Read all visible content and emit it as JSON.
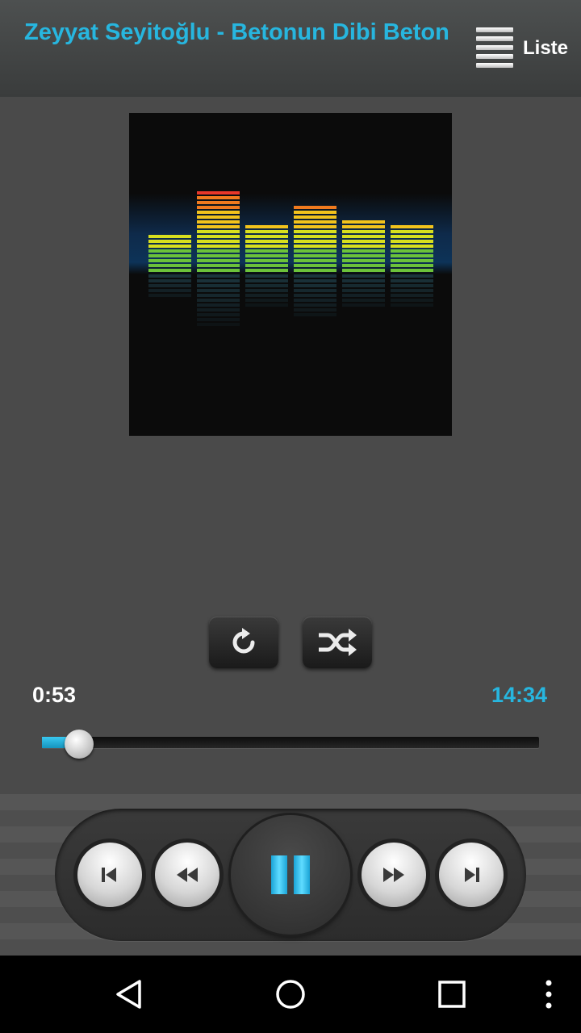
{
  "header": {
    "title": "Zeyyat Seyitoğlu - Betonun Dibi Beton",
    "list_label": "Liste",
    "title_color": "#27b6df"
  },
  "player": {
    "elapsed": "0:53",
    "duration": "14:34",
    "progress": 0.061,
    "state": "playing",
    "accent_color": "#27b6df"
  },
  "album_art": {
    "bar_levels": [
      0.45,
      1.0,
      0.6,
      0.82,
      0.65,
      0.6
    ]
  },
  "icons": {
    "repeat": "repeat-icon",
    "shuffle": "shuffle-icon",
    "previous": "skip-previous-icon",
    "rewind": "rewind-icon",
    "pause": "pause-icon",
    "fast_forward": "fast-forward-icon",
    "next": "skip-next-icon",
    "back": "back-triangle-icon",
    "home": "home-circle-icon",
    "recents": "recents-square-icon",
    "menu": "overflow-menu-icon"
  }
}
